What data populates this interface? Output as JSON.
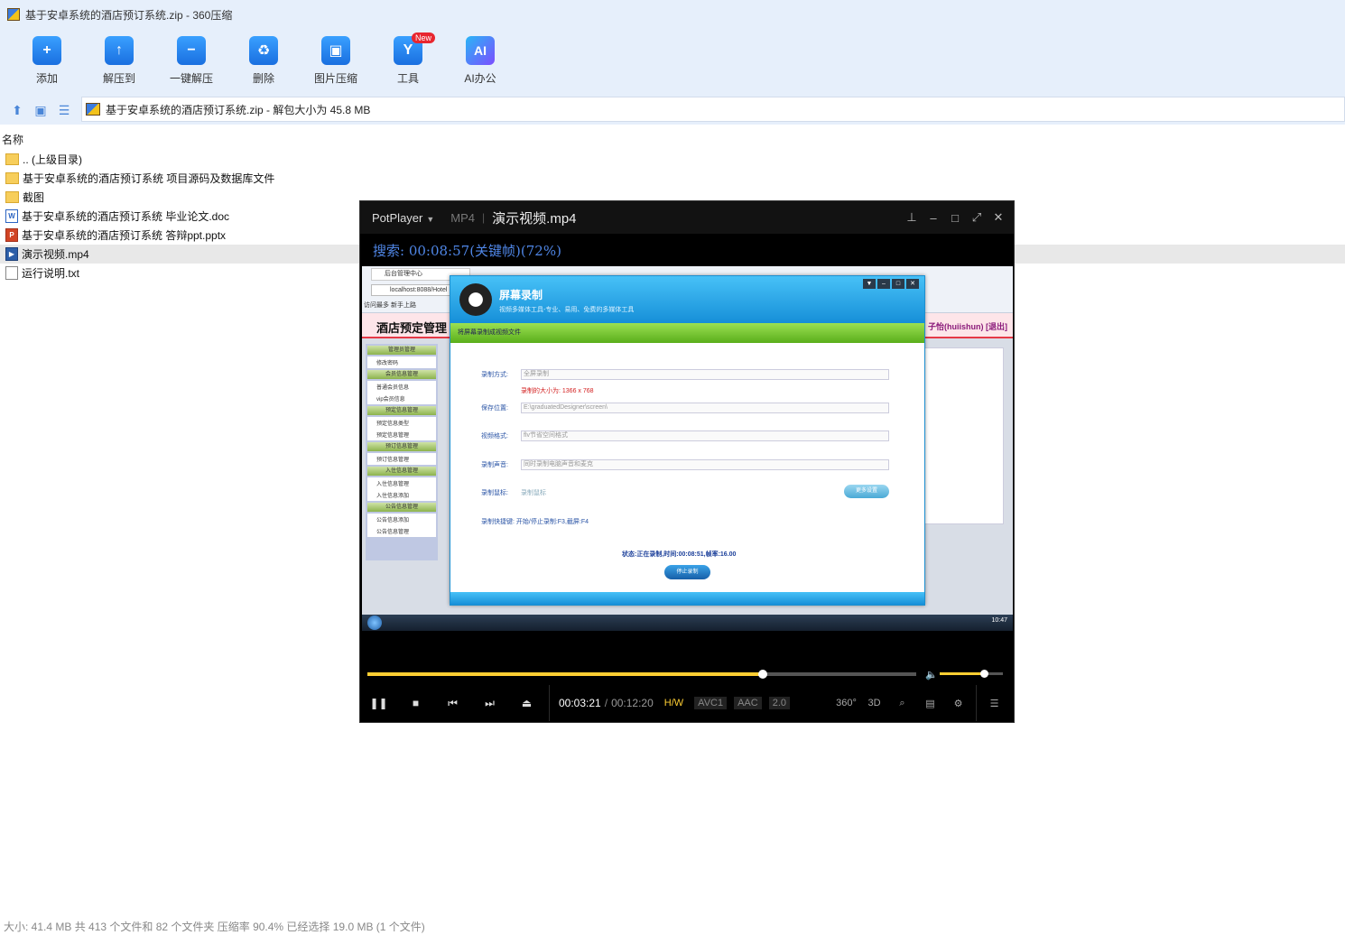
{
  "window": {
    "title": "基于安卓系统的酒店预订系统.zip - 360压缩"
  },
  "toolbar": {
    "items": [
      {
        "label": "添加",
        "icon": "add-icon"
      },
      {
        "label": "解压到",
        "icon": "extract-to-icon"
      },
      {
        "label": "一键解压",
        "icon": "one-click-extract-icon"
      },
      {
        "label": "删除",
        "icon": "delete-icon"
      },
      {
        "label": "图片压缩",
        "icon": "image-compress-icon"
      },
      {
        "label": "工具",
        "icon": "tools-icon",
        "badge": "New"
      },
      {
        "label": "AI办公",
        "icon": "ai-icon",
        "glyph": "AI"
      }
    ]
  },
  "address": {
    "text": "基于安卓系统的酒店预订系统.zip - 解包大小为 45.8 MB"
  },
  "filelist": {
    "header": "名称",
    "rows": [
      {
        "name": ".. (上级目录)",
        "type": "folder"
      },
      {
        "name": "基于安卓系统的酒店预订系统 项目源码及数据库文件",
        "type": "folder"
      },
      {
        "name": "截图",
        "type": "folder"
      },
      {
        "name": "基于安卓系统的酒店预订系统 毕业论文.doc",
        "type": "doc"
      },
      {
        "name": "基于安卓系统的酒店预订系统 答辩ppt.pptx",
        "type": "ppt"
      },
      {
        "name": "演示视频.mp4",
        "type": "mp4",
        "selected": true
      },
      {
        "name": "运行说明.txt",
        "type": "txt"
      }
    ]
  },
  "statusbar": {
    "text": "大小: 41.4 MB 共 413 个文件和 82 个文件夹 压缩率 90.4% 已经选择 19.0 MB (1 个文件)"
  },
  "player": {
    "brand": "PotPlayer",
    "format": "MP4",
    "filename": "演示视频.mp4",
    "seek_message": "搜索: 00:08:57(关键帧)(72%)",
    "progress": 0.72,
    "volume": 0.7,
    "time_current": "00:03:21",
    "time_separator": "/",
    "time_total": "00:12:20",
    "tags": {
      "hw": "H/W",
      "video": "AVC1",
      "audio": "AAC",
      "channels": "2.0"
    },
    "right_buttons": {
      "vr": "360°",
      "three_d": "3D"
    }
  },
  "video_frame": {
    "browser_tab": "后台管理中心",
    "url": "localhost:8088/Hotel",
    "favorites": "访问最多  新手上路",
    "site_title": "酒店预定管理",
    "site_user": "子怡(huiishun) [退出]",
    "sidebar": [
      {
        "group": "管理员管理",
        "items": [
          "修改密码"
        ]
      },
      {
        "group": "会员信息管理",
        "items": [
          "普通会员信息",
          "vip会员信息"
        ]
      },
      {
        "group": "预定信息管理",
        "items": [
          "预定信息类型",
          "预定信息管理"
        ]
      },
      {
        "group": "预订信息管理",
        "items": [
          "预订信息管理"
        ]
      },
      {
        "group": "入住信息管理",
        "items": [
          "入住信息管理",
          "入住信息添加"
        ]
      },
      {
        "group": "公告信息管理",
        "items": [
          "公告信息添加",
          "公告信息管理"
        ]
      }
    ],
    "recorder": {
      "title": "屏幕录制",
      "subtitle": "视频多媒体工具-专业、易用、免费的多媒体工具",
      "bar": "将屏幕录制成视频文件",
      "mode_label": "录制方式:",
      "mode_value": "全屏录制",
      "size_note": "录制的大小为: 1366 x 768",
      "path_label": "保存位置:",
      "path_value": "E:\\graduatedDesigner\\screen\\",
      "format_label": "视频格式:",
      "format_value": "flv节省空间格式",
      "audio_label": "录制声音:",
      "audio_value": "同时录制电脑声音和麦克",
      "cursor_label": "录制鼠标:",
      "cursor_value": "录制鼠标",
      "more_button": "更多设置",
      "hotkey": "录制快捷键: 开始/停止录制:F3,截屏:F4",
      "status": "状态:正在录制,时间:00:08:51,帧率:16.00",
      "stop_button": "停止录制"
    },
    "clock": "10:47"
  }
}
